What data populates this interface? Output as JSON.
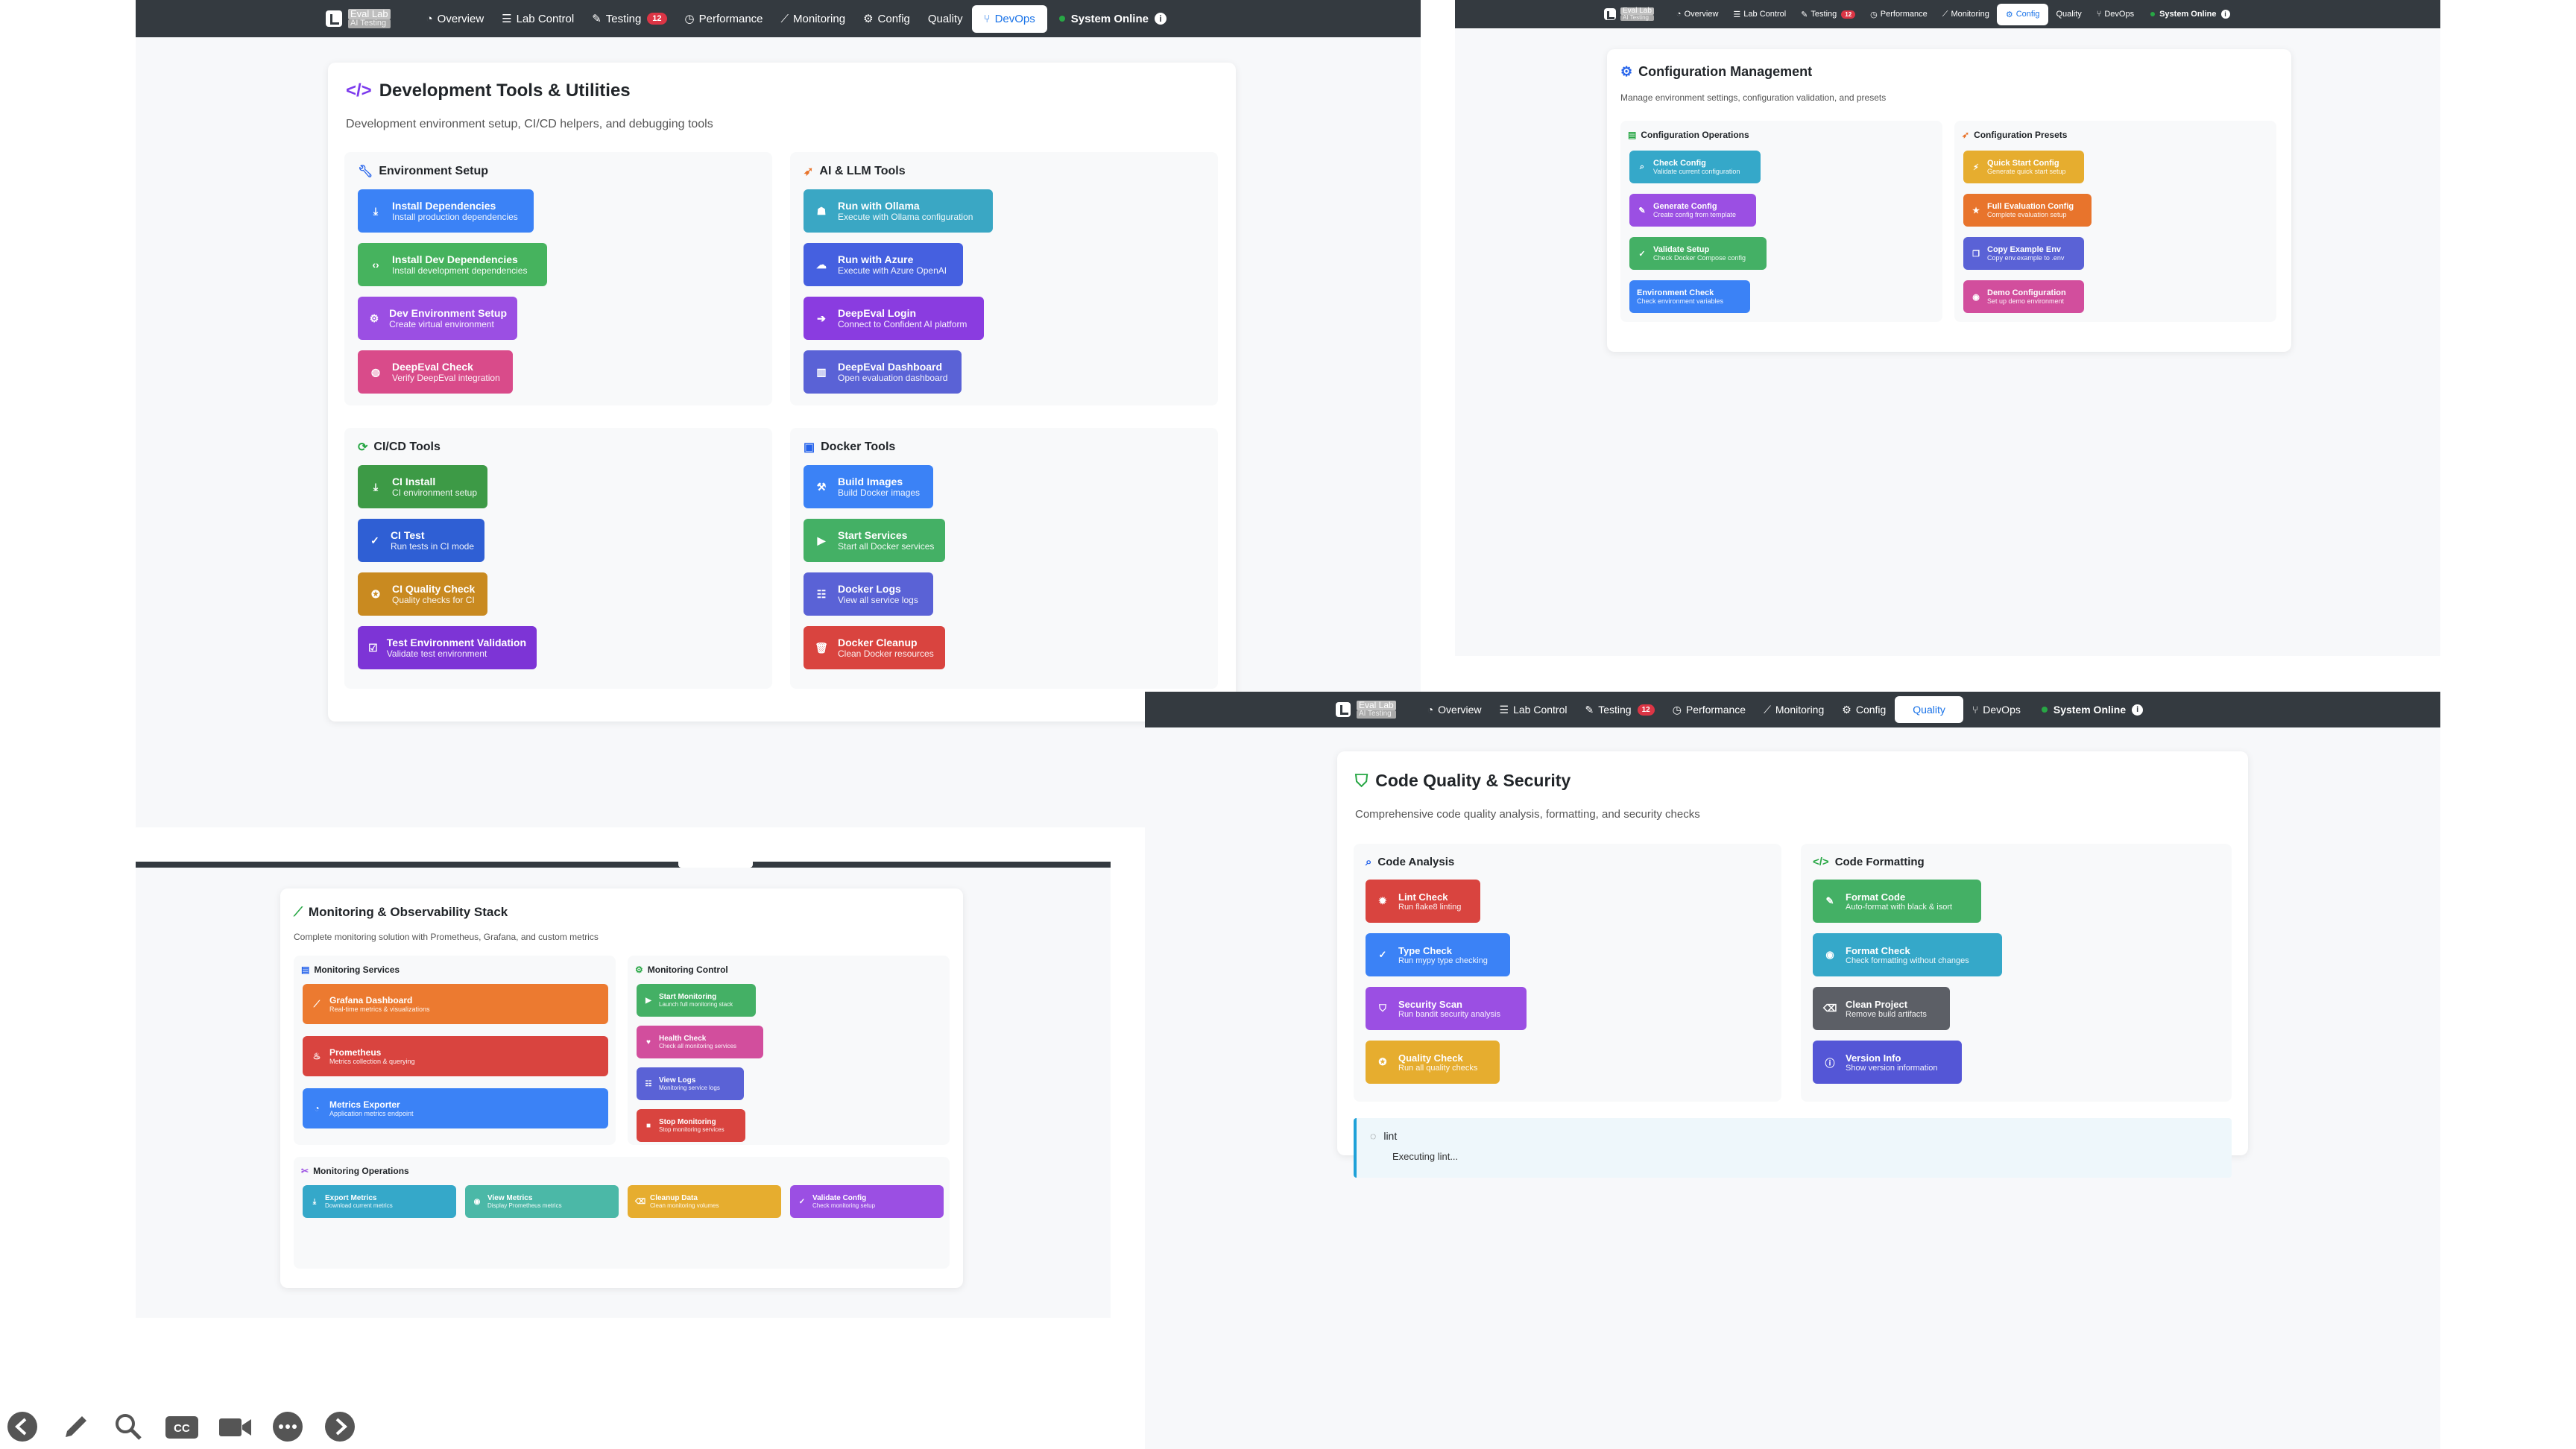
{
  "nav": {
    "brand_name": "Eval Lab",
    "brand_sub": "AI Testing",
    "items": [
      "Overview",
      "Lab Control",
      "Testing",
      "Performance",
      "Monitoring",
      "Config",
      "Quality",
      "DevOps"
    ],
    "testing_badge": "12",
    "status": "System Online"
  },
  "devops": {
    "title": "Development Tools & Utilities",
    "subtitle": "Development environment setup, CI/CD helpers, and debugging tools",
    "env_title": "Environment Setup",
    "env": [
      {
        "label": "Install Dependencies",
        "sub": "Install production dependencies"
      },
      {
        "label": "Install Dev Dependencies",
        "sub": "Install development dependencies"
      },
      {
        "label": "Dev Environment Setup",
        "sub": "Create virtual environment"
      },
      {
        "label": "DeepEval Check",
        "sub": "Verify DeepEval integration"
      }
    ],
    "ai_title": "AI & LLM Tools",
    "ai": [
      {
        "label": "Run with Ollama",
        "sub": "Execute with Ollama configuration"
      },
      {
        "label": "Run with Azure",
        "sub": "Execute with Azure OpenAI"
      },
      {
        "label": "DeepEval Login",
        "sub": "Connect to Confident AI platform"
      },
      {
        "label": "DeepEval Dashboard",
        "sub": "Open evaluation dashboard"
      }
    ],
    "ci_title": "CI/CD Tools",
    "ci": [
      {
        "label": "CI Install",
        "sub": "CI environment setup"
      },
      {
        "label": "CI Test",
        "sub": "Run tests in CI mode"
      },
      {
        "label": "CI Quality Check",
        "sub": "Quality checks for CI"
      },
      {
        "label": "Test Environment Validation",
        "sub": "Validate test environment"
      }
    ],
    "docker_title": "Docker Tools",
    "docker": [
      {
        "label": "Build Images",
        "sub": "Build Docker images"
      },
      {
        "label": "Start Services",
        "sub": "Start all Docker services"
      },
      {
        "label": "Docker Logs",
        "sub": "View all service logs"
      },
      {
        "label": "Docker Cleanup",
        "sub": "Clean Docker resources"
      }
    ]
  },
  "config": {
    "title": "Configuration Management",
    "subtitle": "Manage environment settings, configuration validation, and presets",
    "ops_title": "Configuration Operations",
    "ops": [
      {
        "label": "Check Config",
        "sub": "Validate current configuration"
      },
      {
        "label": "Generate Config",
        "sub": "Create config from template"
      },
      {
        "label": "Validate Setup",
        "sub": "Check Docker Compose config"
      },
      {
        "label": "Environment Check",
        "sub": "Check environment variables"
      }
    ],
    "presets_title": "Configuration Presets",
    "presets": [
      {
        "label": "Quick Start Config",
        "sub": "Generate quick start setup"
      },
      {
        "label": "Full Evaluation Config",
        "sub": "Complete evaluation setup"
      },
      {
        "label": "Copy Example Env",
        "sub": "Copy env.example to .env"
      },
      {
        "label": "Demo Configuration",
        "sub": "Set up demo environment"
      }
    ]
  },
  "monitoring": {
    "title": "Monitoring & Observability Stack",
    "subtitle": "Complete monitoring solution with Prometheus, Grafana, and custom metrics",
    "services_title": "Monitoring Services",
    "services": [
      {
        "label": "Grafana Dashboard",
        "sub": "Real-time metrics & visualizations"
      },
      {
        "label": "Prometheus",
        "sub": "Metrics collection & querying"
      },
      {
        "label": "Metrics Exporter",
        "sub": "Application metrics endpoint"
      }
    ],
    "control_title": "Monitoring Control",
    "control": [
      {
        "label": "Start Monitoring",
        "sub": "Launch full monitoring stack"
      },
      {
        "label": "Health Check",
        "sub": "Check all monitoring services"
      },
      {
        "label": "View Logs",
        "sub": "Monitoring service logs"
      },
      {
        "label": "Stop Monitoring",
        "sub": "Stop monitoring services"
      }
    ],
    "ops_title": "Monitoring Operations",
    "ops": [
      {
        "label": "Export Metrics",
        "sub": "Download current metrics"
      },
      {
        "label": "View Metrics",
        "sub": "Display Prometheus metrics"
      },
      {
        "label": "Cleanup Data",
        "sub": "Clean monitoring volumes"
      },
      {
        "label": "Validate Config",
        "sub": "Check monitoring setup"
      }
    ]
  },
  "quality": {
    "title": "Code Quality & Security",
    "subtitle": "Comprehensive code quality analysis, formatting, and security checks",
    "analysis_title": "Code Analysis",
    "analysis": [
      {
        "label": "Lint Check",
        "sub": "Run flake8 linting"
      },
      {
        "label": "Type Check",
        "sub": "Run mypy type checking"
      },
      {
        "label": "Security Scan",
        "sub": "Run bandit security analysis"
      },
      {
        "label": "Quality Check",
        "sub": "Run all quality checks"
      }
    ],
    "format_title": "Code Formatting",
    "format": [
      {
        "label": "Format Code",
        "sub": "Auto-format with black & isort"
      },
      {
        "label": "Format Check",
        "sub": "Check formatting without changes"
      },
      {
        "label": "Clean Project",
        "sub": "Remove build artifacts"
      },
      {
        "label": "Version Info",
        "sub": "Show version information"
      }
    ],
    "status_title": "lint",
    "status_text": "Executing lint..."
  },
  "icons": {
    "back": "arrow-left-icon",
    "pen": "pencil-icon",
    "search": "search-icon",
    "captions": "cc-icon",
    "video": "video-icon",
    "more": "more-icon",
    "forward": "arrow-right-icon"
  }
}
